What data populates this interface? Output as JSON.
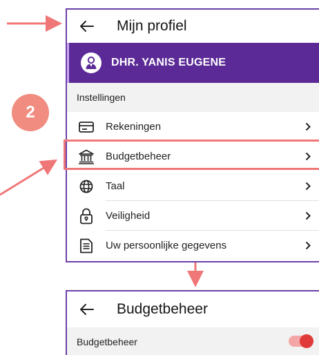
{
  "profile_screen": {
    "title": "Mijn profiel",
    "user_name": "DHR. YANIS EUGENE",
    "section_label": "Instellingen",
    "items": [
      {
        "label": "Rekeningen",
        "icon": "card-icon"
      },
      {
        "label": "Budgetbeheer",
        "icon": "bank-icon"
      },
      {
        "label": "Taal",
        "icon": "globe-icon"
      },
      {
        "label": "Veiligheid",
        "icon": "lock-icon"
      },
      {
        "label": "Uw persoonlijke gegevens",
        "icon": "document-icon"
      }
    ]
  },
  "budget_screen": {
    "title": "Budgetbeheer",
    "setting_label": "Budgetbeheer",
    "toggle_on": true
  },
  "annotations": {
    "step_number": "2",
    "arrow_color": "#ef7777",
    "badge_color": "#f08c80"
  },
  "colors": {
    "purple": "#5b2a97",
    "border": "#6a3fa8",
    "toggle": "#e03a3a"
  }
}
